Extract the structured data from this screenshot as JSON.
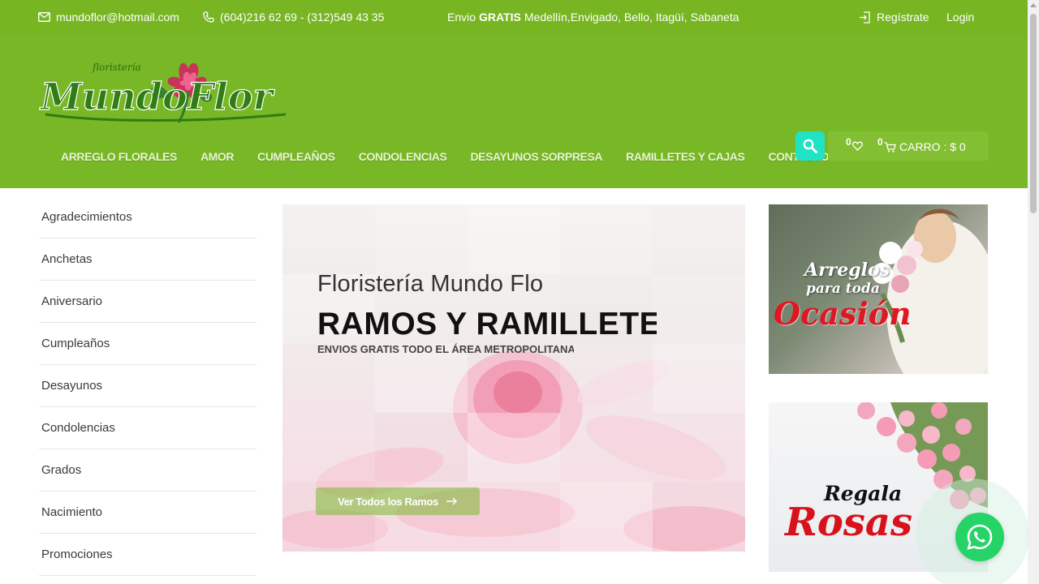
{
  "topbar": {
    "email": "mundoflor@hotmail.com",
    "phone": "(604)216 62 69 - (312)549 43 35",
    "shipping_prefix": "Envio",
    "shipping_bold": "GRATIS",
    "shipping_suffix": "Medellín,Envigado, Bello, Itagüí, Sabaneta",
    "register_label": "Regístrate",
    "login_label": "Login"
  },
  "logo": {
    "small_text": "floristería",
    "main_text": "MundoFlor"
  },
  "nav": {
    "items": [
      {
        "label": "ARREGLO FLORALES"
      },
      {
        "label": "AMOR"
      },
      {
        "label": "CUMPLEAÑOS"
      },
      {
        "label": "CONDOLENCIAS"
      },
      {
        "label": "DESAYUNOS SORPRESA"
      },
      {
        "label": "RAMILLETES Y CAJAS"
      },
      {
        "label": "CONTACTO"
      }
    ]
  },
  "header_tools": {
    "wishlist_count": "0",
    "cart_count": "0",
    "cart_label": "CARRO : $ 0"
  },
  "categories": [
    "Agradecimientos",
    "Anchetas",
    "Aniversario",
    "Cumpleaños",
    "Desayunos",
    "Condolencias",
    "Grados",
    "Nacimiento",
    "Promociones"
  ],
  "slider": {
    "subtitle": "Floristería Mundo Flo",
    "title": "RAMOS Y RAMILLETES",
    "small": "ENVIOS GRATIS TODO EL ÁREA METROPOLITANA",
    "button_label": "Ver Todos los Ramos"
  },
  "banners": {
    "banner1": {
      "line1": "Arreglos",
      "line2": "para toda",
      "line3": "Ocasión"
    },
    "banner2": {
      "line1": "Regala",
      "line2": "Rosas"
    }
  },
  "colors": {
    "header_green": "#78b725",
    "accent_teal": "#20e3c4",
    "whatsapp": "#25d366"
  }
}
